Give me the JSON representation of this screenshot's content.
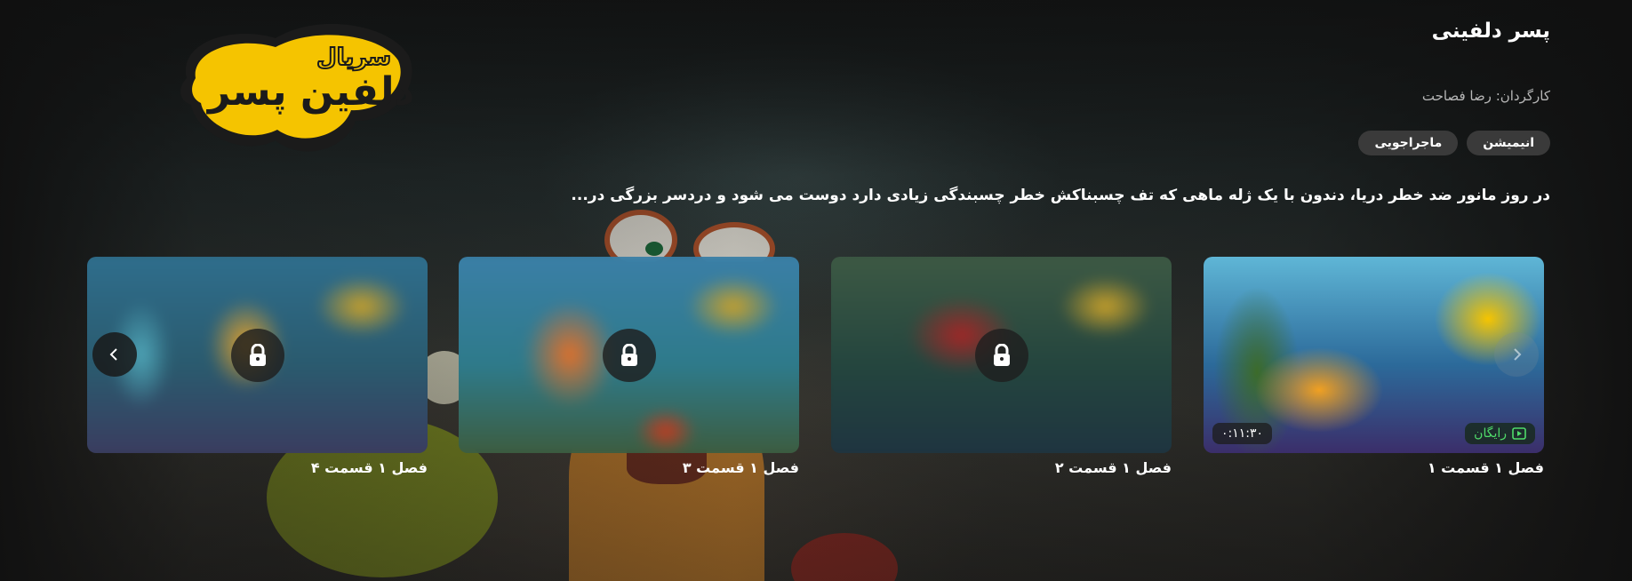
{
  "show": {
    "title": "پسر دلفینی",
    "director": "کارگردان: رضا فصاحت",
    "genres": [
      "انیمیشن",
      "ماجراجویی"
    ],
    "synopsis": "در روز مانور ضد خطر دریا، دندون با یک ژله ماهی که تف چسبناکش خطر چسبندگی زیادی دارد دوست می شود و دردسر بزرگی در...",
    "logo_text_small": "سریال",
    "logo_text_large": "دلفین پسر"
  },
  "episodes": [
    {
      "title": "فصل ۱ قسمت ۱",
      "locked": false,
      "badge": "رایگان",
      "duration": "۰:۱۱:۳۰"
    },
    {
      "title": "فصل ۱ قسمت ۲",
      "locked": true
    },
    {
      "title": "فصل ۱ قسمت ۳",
      "locked": true
    },
    {
      "title": "فصل ۱ قسمت ۴",
      "locked": true
    }
  ],
  "colors": {
    "free_green": "#4fdc6a",
    "logo_yellow": "#f5c400"
  },
  "icons": {
    "lock": "lock-icon",
    "play": "play-icon",
    "prev": "chevron-left-icon",
    "next": "chevron-right-icon"
  }
}
